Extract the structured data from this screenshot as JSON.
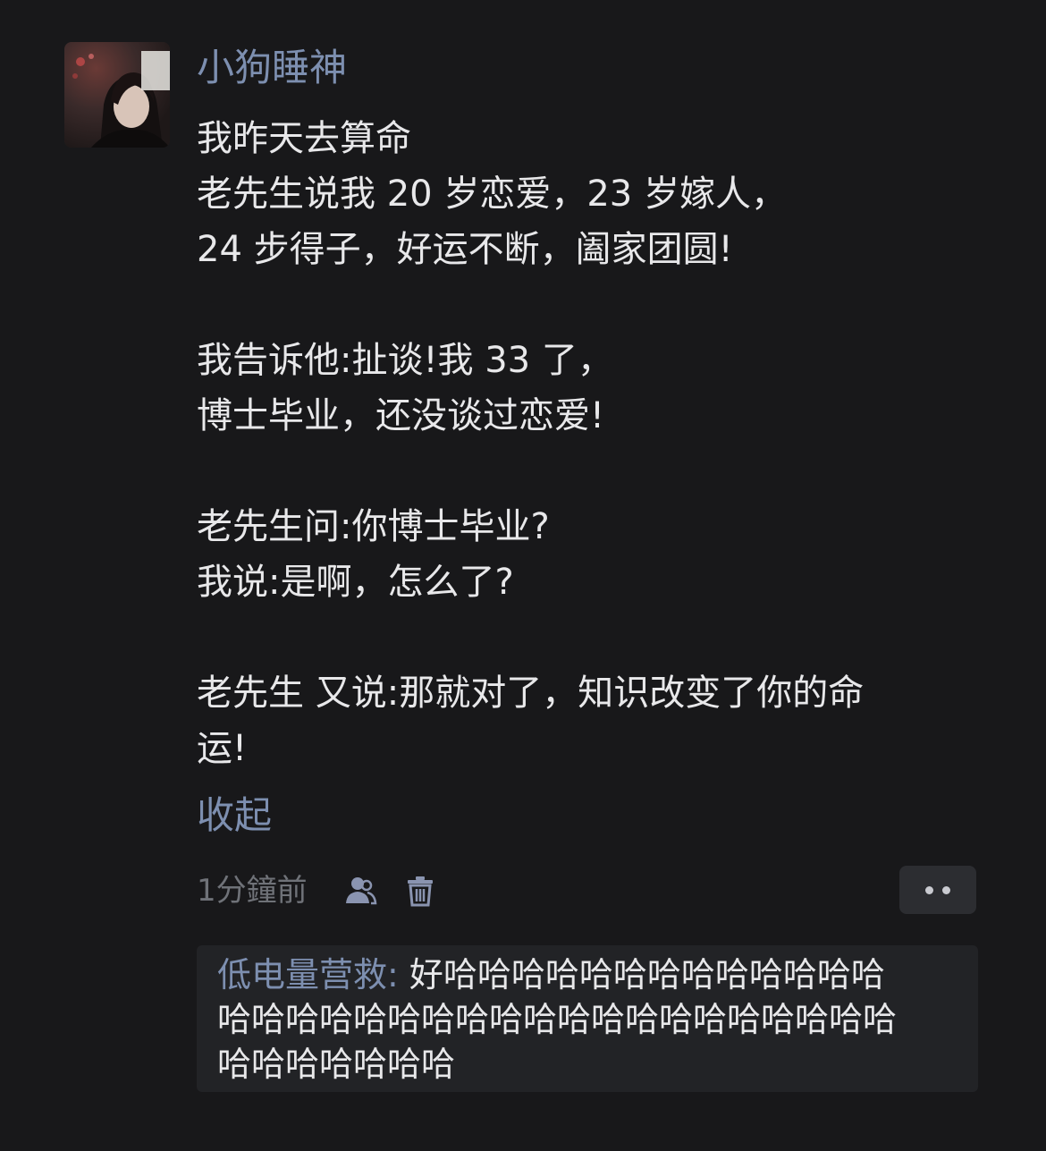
{
  "post": {
    "author": "小狗睡神",
    "avatar_icon": "avatar-photo",
    "lines": [
      "我昨天去算命",
      "老先生说我 20 岁恋爱，23 岁嫁人，",
      "24 步得子，好运不断，阖家团圆!",
      "",
      "我告诉他:扯谈!我 33 了，",
      "博士毕业，还没谈过恋爱!",
      "",
      "老先生问:你博士毕业?",
      "我说:是啊，怎么了?",
      "",
      "老先生 又说:那就对了，知识改变了你的命",
      "运!"
    ],
    "collapse_label": "收起",
    "timestamp": "1分鐘前",
    "icons": {
      "users": "users-icon",
      "trash": "trash-icon",
      "more": "more-dots-icon"
    }
  },
  "reply": {
    "author": "低电量营救",
    "separator": ": ",
    "lines": [
      "好哈哈哈哈哈哈哈哈哈哈哈哈哈",
      "哈哈哈哈哈哈哈哈哈哈哈哈哈哈哈哈哈哈哈哈",
      "哈哈哈哈哈哈哈"
    ]
  },
  "colors": {
    "background": "#18181a",
    "accent": "#7d8fb0",
    "text": "#e8e8ea",
    "muted": "#6f7278",
    "reply_background": "#222326"
  }
}
